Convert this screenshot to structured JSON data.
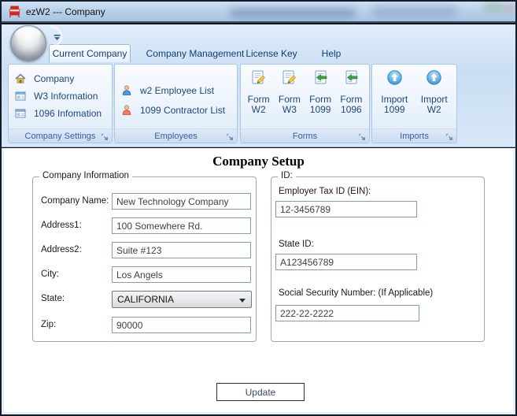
{
  "window": {
    "title": "ezW2 --- Company"
  },
  "tabs": {
    "current": "Current Company",
    "management": "Company Management",
    "license": "License Key",
    "help": "Help"
  },
  "ribbon": {
    "company_settings": {
      "title": "Company Settings",
      "company": "Company",
      "w3": "W3 Information",
      "i1096": "1096 Infomation"
    },
    "employees": {
      "title": "Employees",
      "w2_list": "w2 Employee List",
      "contractor_list": "1099 Contractor List"
    },
    "forms": {
      "title": "Forms",
      "w2_l1": "Form",
      "w2_l2": "W2",
      "w3_l1": "Form",
      "w3_l2": "W3",
      "f1099_l1": "Form",
      "f1099_l2": "1099",
      "f1096_l1": "Form",
      "f1096_l2": "1096"
    },
    "imports": {
      "title": "Imports",
      "i1099_l1": "Import",
      "i1099_l2": "1099",
      "iw2_l1": "Import",
      "iw2_l2": "W2"
    }
  },
  "main": {
    "heading": "Company Setup",
    "company_info": {
      "title": "Company Information",
      "company_name_label": "Company Name:",
      "company_name_value": "New Technology Company",
      "address1_label": "Address1:",
      "address1_value": "100 Somewhere Rd.",
      "address2_label": "Address2:",
      "address2_value": "Suite #123",
      "city_label": "City:",
      "city_value": "Los Angels",
      "state_label": "State:",
      "state_value": "CALIFORNIA",
      "zip_label": "Zip:",
      "zip_value": "90000"
    },
    "ids": {
      "title": "ID:",
      "ein_label": "Employer Tax ID (EIN):",
      "ein_value": "12-3456789",
      "state_id_label": "State ID:",
      "state_id_value": "A123456789",
      "ssn_label": "Social Security Number: (If Applicable)",
      "ssn_value": "222-22-2222"
    },
    "update_label": "Update"
  },
  "colors": {
    "ribbon_text": "#1e477e",
    "tab_text": "#123d74",
    "group_title": "#3a6096"
  }
}
